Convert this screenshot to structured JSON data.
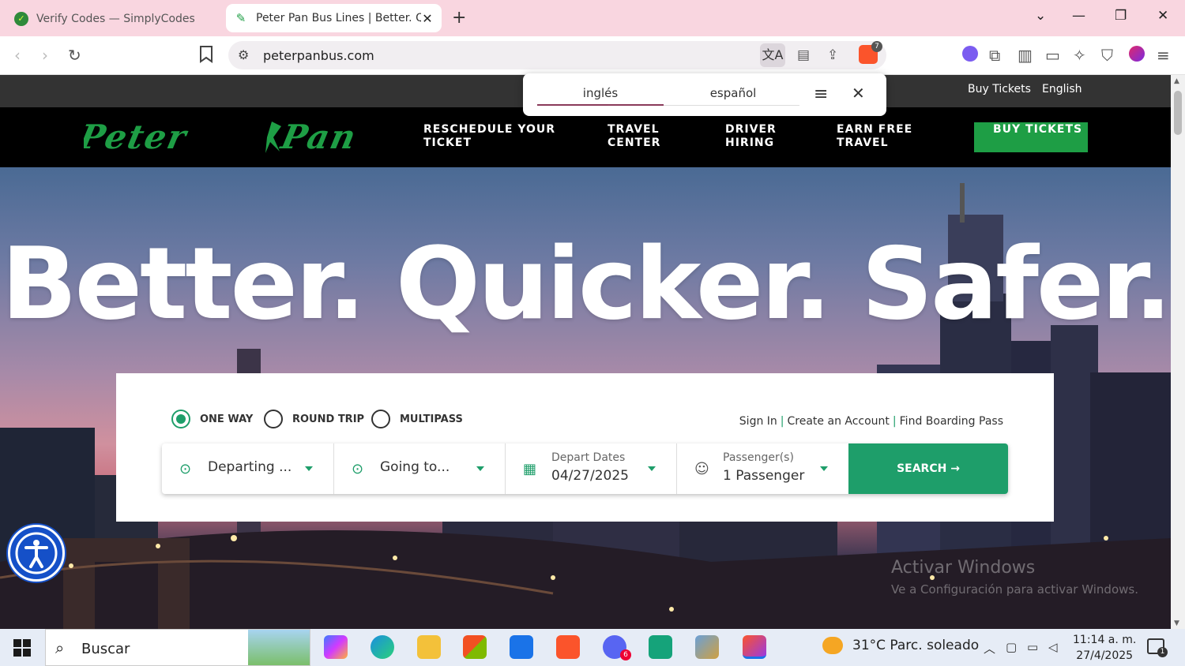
{
  "browser": {
    "tabs": [
      {
        "title": "Verify Codes — SimplyCodes",
        "active": false
      },
      {
        "title": "Peter Pan Bus Lines | Better. Qu",
        "active": true
      }
    ],
    "new_tab_icon": "plus-icon",
    "url": "peterpanbus.com",
    "brave_shield_count": "7"
  },
  "translate_popup": {
    "source_lang": "inglés",
    "target_lang": "español"
  },
  "site": {
    "topbar": {
      "buy_tickets": "Buy Tickets",
      "language": "English"
    },
    "nav": {
      "reschedule": "RESCHEDULE YOUR TICKET",
      "travel_center": "TRAVEL CENTER",
      "driver_hiring": "DRIVER HIRING",
      "earn_free_travel": "EARN FREE TRAVEL",
      "buy_tickets": "BUY TICKETS"
    },
    "hero_title": "Better. Quicker. Safer.",
    "booking": {
      "trip_types": [
        "ONE WAY",
        "ROUND TRIP",
        "MULTIPASS"
      ],
      "selected_trip": "ONE WAY",
      "sign_in": "Sign In",
      "create_account": "Create an Account",
      "find_boarding_pass": "Find Boarding Pass",
      "departing_placeholder": "Departing ...",
      "going_placeholder": "Going to...",
      "depart_label": "Depart Dates",
      "depart_value": "04/27/2025",
      "passengers_label": "Passenger(s)",
      "passengers_value": "1 Passenger",
      "search_label": "SEARCH"
    },
    "activate_windows": {
      "line1": "Activar Windows",
      "line2": "Ve a Configuración para activar Windows."
    }
  },
  "taskbar": {
    "search_placeholder": "Buscar",
    "weather": "31°C  Parc. soleado",
    "time": "11:14 a. m.",
    "date": "27/4/2025",
    "notification_count": "1",
    "discord_badge": "6"
  },
  "colors": {
    "brand_green": "#1e9e45",
    "search_green": "#1e9e6a",
    "tab_strip": "#f9d6e0",
    "a11y_blue": "#1550c8"
  }
}
